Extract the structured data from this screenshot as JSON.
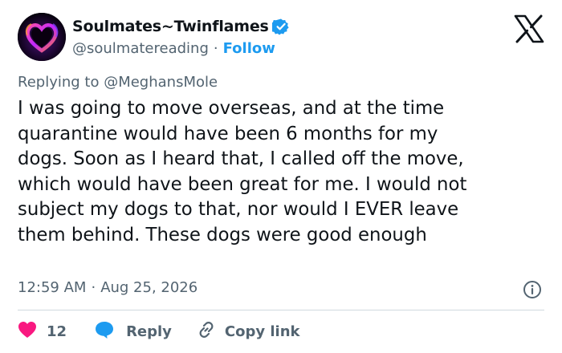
{
  "author": {
    "display_name": "Soulmates~Twinflames",
    "handle": "@soulmatereading",
    "separator": "·",
    "follow_label": "Follow",
    "verified_color": "#1d9bf0"
  },
  "reply_context": {
    "prefix": "Replying to ",
    "mention": "@MeghansMole"
  },
  "tweet": {
    "lines": [
      "I was going to move overseas, and at the time",
      "quarantine would have been 6 months for my",
      "dogs. Soon as I heard that, I called off the move,",
      "which would have been great for me. I would not",
      "subject my dogs to that, nor would I EVER leave",
      "them behind. These dogs were good enough"
    ]
  },
  "meta": {
    "time": "12:59 AM",
    "separator": "·",
    "date": "Aug 25, 2026"
  },
  "actions": {
    "like_count": "12",
    "reply_label": "Reply",
    "copy_link_label": "Copy link"
  },
  "icons": {
    "logo": "x-logo-icon",
    "verified": "verified-badge-icon",
    "info": "info-icon",
    "like": "heart-icon",
    "reply": "speech-bubble-icon",
    "copy": "link-icon"
  },
  "colors": {
    "text": "#0f1419",
    "secondary": "#536471",
    "accent": "#1d9bf0",
    "like": "#f91880",
    "divider": "#cfd9de"
  }
}
